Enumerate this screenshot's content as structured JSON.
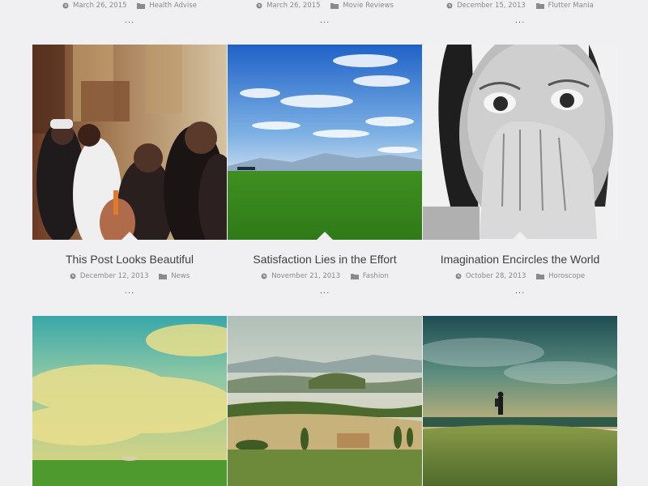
{
  "row1": [
    {
      "date": "March 26, 2015",
      "category": "Health Advise",
      "more": "..."
    },
    {
      "date": "March 26, 2015",
      "category": "Movie Reviews",
      "more": "..."
    },
    {
      "date": "December 15, 2013",
      "category": "Flutter Mania",
      "more": "..."
    }
  ],
  "row2": [
    {
      "title": "This Post Looks Beautiful",
      "date": "December 12, 2013",
      "category": "News",
      "more": "...",
      "image": "crowd-photo"
    },
    {
      "title": "Satisfaction Lies in the Effort",
      "date": "November 21, 2013",
      "category": "Fashion",
      "more": "...",
      "image": "green-field-blue-sky-photo"
    },
    {
      "title": "Imagination Encircles the World",
      "date": "October 28, 2013",
      "category": "Horoscope",
      "more": "...",
      "image": "girl-covering-mouth-photo"
    }
  ],
  "row3": [
    {
      "image": "golden-sky-meadow-photo"
    },
    {
      "image": "tuscan-hills-photo"
    },
    {
      "image": "hiker-on-hill-photo"
    }
  ],
  "icons": {
    "date": "clock-icon",
    "category": "folder-icon"
  },
  "colors": {
    "background": "#f0eff2",
    "text": "#3f3f3f",
    "meta": "#8a8a8a"
  }
}
